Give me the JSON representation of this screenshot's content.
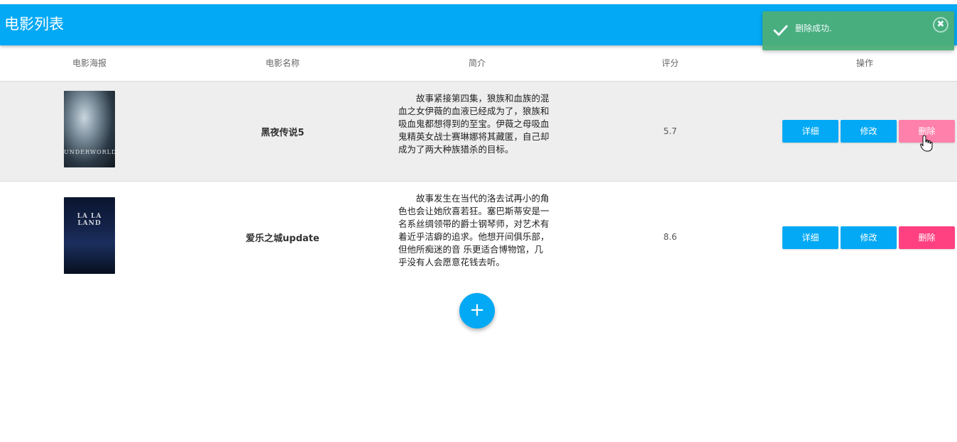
{
  "appbar": {
    "title": "电影列表"
  },
  "table": {
    "headers": [
      "电影海报",
      "电影名称",
      "简介",
      "评分",
      "操作"
    ],
    "rows": [
      {
        "poster_caption": "UNDERWORLD",
        "name": "黑夜传说5",
        "description": "故事紧接第四集，狼族和血族的混血之女伊薇的血液已经成为了，狼族和吸血鬼都想得到的至宝。伊薇之母吸血鬼精英女战士赛琳娜将其藏匿，自己却成为了两大种族猎杀的目标。",
        "score": "5.7",
        "actions": {
          "detail": "详细",
          "edit": "修改",
          "delete": "删除"
        }
      },
      {
        "poster_caption": "LA LA LAND",
        "name": "爱乐之城update",
        "description": "故事发生在当代的洛去试再小的角色也会让她欣喜若狂。塞巴斯蒂安是一名系丝绸领带的爵士钢琴师，对艺术有着近乎洁癖的追求。他想开间俱乐部，但他所痴迷的音 乐更适合博物馆，几乎没有人会愿意花钱去听。",
        "score": "8.6",
        "actions": {
          "detail": "详细",
          "edit": "修改",
          "delete": "删除"
        }
      }
    ]
  },
  "fab": {
    "label": "+"
  },
  "toast": {
    "message": "删除成功."
  },
  "colors": {
    "primary": "#03a9f4",
    "accent": "#ff4081",
    "success": "#4caf78"
  }
}
